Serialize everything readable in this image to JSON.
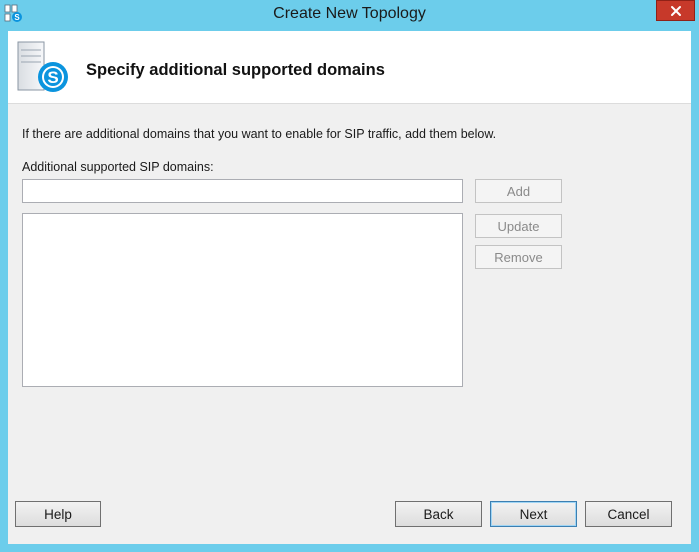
{
  "window": {
    "title": "Create New Topology"
  },
  "icons": {
    "app": "topology-app-icon",
    "header": "skype-server-icon",
    "close": "close-icon"
  },
  "header": {
    "title": "Specify additional supported domains"
  },
  "main": {
    "description": "If there are additional domains that you want to enable for SIP traffic, add them below.",
    "domains_label": "Additional supported SIP domains:",
    "domain_input_value": "",
    "domains_list": [],
    "add_label": "Add",
    "update_label": "Update",
    "remove_label": "Remove"
  },
  "footer": {
    "help_label": "Help",
    "back_label": "Back",
    "next_label": "Next",
    "cancel_label": "Cancel"
  },
  "colors": {
    "title_bar": "#6ccdeb",
    "close_button": "#c7392a",
    "skype_blue": "#0b94de"
  }
}
